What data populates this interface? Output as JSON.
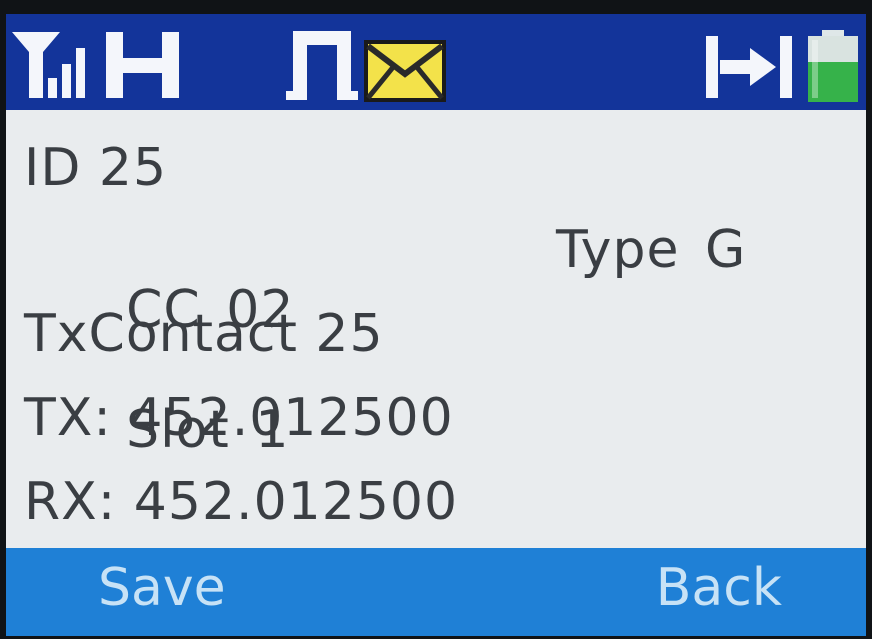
{
  "status_bar": {
    "icons": [
      "signal-strength-icon",
      "channel-mode-h-icon",
      "digital-pulse-icon",
      "message-envelope-icon",
      "export-transfer-icon",
      "battery-icon"
    ],
    "colors": {
      "bar_background": "#13349a",
      "icon_white": "#f4f6fb",
      "envelope_yellow": "#f3e24a",
      "battery_green": "#36b24a"
    }
  },
  "contact_info": {
    "id_line": "ID 25",
    "cc_label": "CC 02",
    "slot_label": "Slot 1",
    "type_label": "Type G",
    "tx_contact_line": "TxContact 25",
    "tx_line": "TX: 452.012500",
    "rx_line": "RX: 452.012500"
  },
  "softkeys": {
    "left_label": "Save",
    "right_label": "Back",
    "bar_color": "#1f80d6"
  },
  "screen_background": "#e9ecee"
}
